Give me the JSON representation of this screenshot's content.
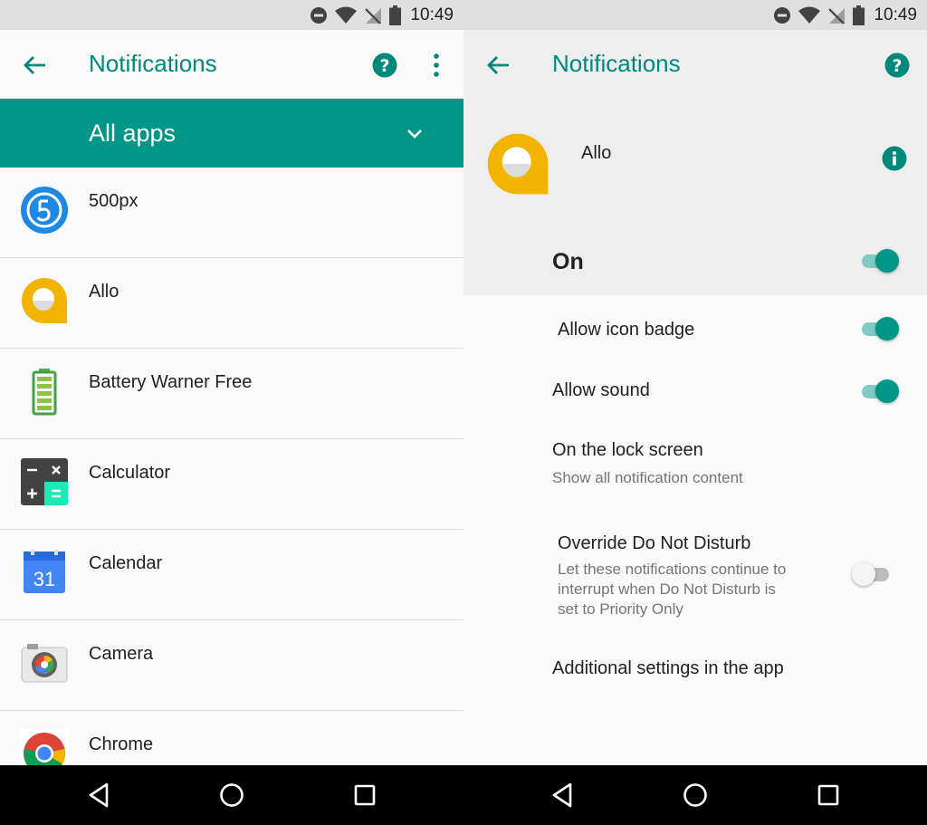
{
  "status_bar": {
    "time": "10:49"
  },
  "left": {
    "title": "Notifications",
    "filter_label": "All apps",
    "apps": [
      {
        "name": "500px"
      },
      {
        "name": "Allo"
      },
      {
        "name": "Battery Warner Free"
      },
      {
        "name": "Calculator"
      },
      {
        "name": "Calendar",
        "icon_text": "31"
      },
      {
        "name": "Camera"
      },
      {
        "name": "Chrome"
      }
    ]
  },
  "right": {
    "title": "Notifications",
    "app_name": "Allo",
    "master_label": "On",
    "master_on": true,
    "settings": {
      "icon_badge": {
        "title": "Allow icon badge",
        "on": true
      },
      "sound": {
        "title": "Allow sound",
        "on": true
      },
      "lock_screen": {
        "title": "On the lock screen",
        "subtitle": "Show all notification content"
      },
      "dnd": {
        "title": "Override Do Not Disturb",
        "subtitle_lines": [
          "Let these notifications continue to",
          "interrupt when Do Not Disturb is",
          "set to Priority Only"
        ],
        "on": false
      },
      "additional": {
        "title": "Additional settings in the app"
      }
    }
  },
  "colors": {
    "accent": "#009688",
    "title_text": "#00897b",
    "toggle_track_on": "#80cbc4"
  },
  "icons": [
    "dnd-icon",
    "wifi-icon",
    "no-signal-icon",
    "battery-icon",
    "back-arrow-icon",
    "help-icon",
    "more-vert-icon",
    "chevron-down-icon",
    "info-icon",
    "nav-back-icon",
    "nav-home-icon",
    "nav-recents-icon"
  ]
}
